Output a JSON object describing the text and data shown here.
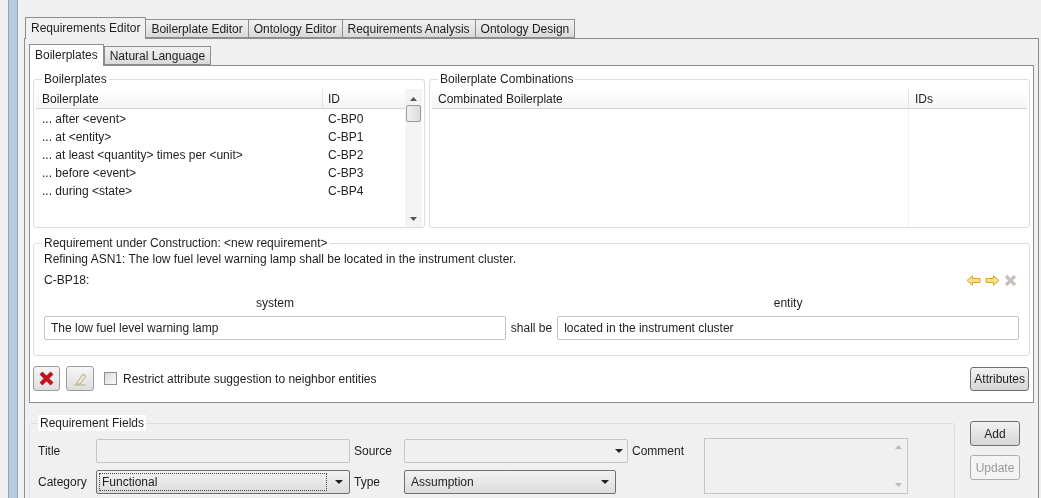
{
  "tabs": [
    {
      "label": "Requirements Editor",
      "selected": true
    },
    {
      "label": "Boilerplate Editor",
      "selected": false
    },
    {
      "label": "Ontology Editor",
      "selected": false
    },
    {
      "label": "Requirements Analysis",
      "selected": false
    },
    {
      "label": "Ontology Design",
      "selected": false
    }
  ],
  "subtabs": [
    {
      "label": "Boilerplates",
      "selected": true
    },
    {
      "label": "Natural Language",
      "selected": false
    }
  ],
  "boilerplates": {
    "title": "Boilerplates",
    "columns": [
      "Boilerplate",
      "ID"
    ],
    "rows": [
      {
        "boilerplate": "... after <event>",
        "id": "C-BP0"
      },
      {
        "boilerplate": "... at <entity>",
        "id": "C-BP1"
      },
      {
        "boilerplate": "... at least <quantity> times per <unit>",
        "id": "C-BP2"
      },
      {
        "boilerplate": "... before <event>",
        "id": "C-BP3"
      },
      {
        "boilerplate": "... during <state>",
        "id": "C-BP4"
      }
    ]
  },
  "combinations": {
    "title": "Boilerplate Combinations",
    "columns": [
      "Combinated Boilerplate",
      "IDs"
    ]
  },
  "construction": {
    "title": "Requirement under Construction: <new requirement>",
    "refining": "Refining ASN1:  The low fuel level warning lamp shall be located in the instrument cluster.",
    "boilerplate_id": "C-BP18:",
    "slots": [
      {
        "kind": "field",
        "label": "system",
        "value": "The low fuel level warning lamp"
      },
      {
        "kind": "text",
        "value": "shall be"
      },
      {
        "kind": "field",
        "label": "entity",
        "value": "located in the instrument cluster"
      }
    ]
  },
  "restrict_checkbox": {
    "label": "Restrict attribute suggestion to neighbor entities",
    "checked": false
  },
  "attributes_button": "Attributes",
  "fields": {
    "title": "Requirement Fields",
    "title_label": "Title",
    "source_label": "Source",
    "comment_label": "Comment",
    "category_label": "Category",
    "category_value": "Functional",
    "type_label": "Type",
    "type_value": "Assumption"
  },
  "buttons": [
    {
      "label": "Add",
      "disabled": false
    },
    {
      "label": "Update",
      "disabled": true
    }
  ]
}
